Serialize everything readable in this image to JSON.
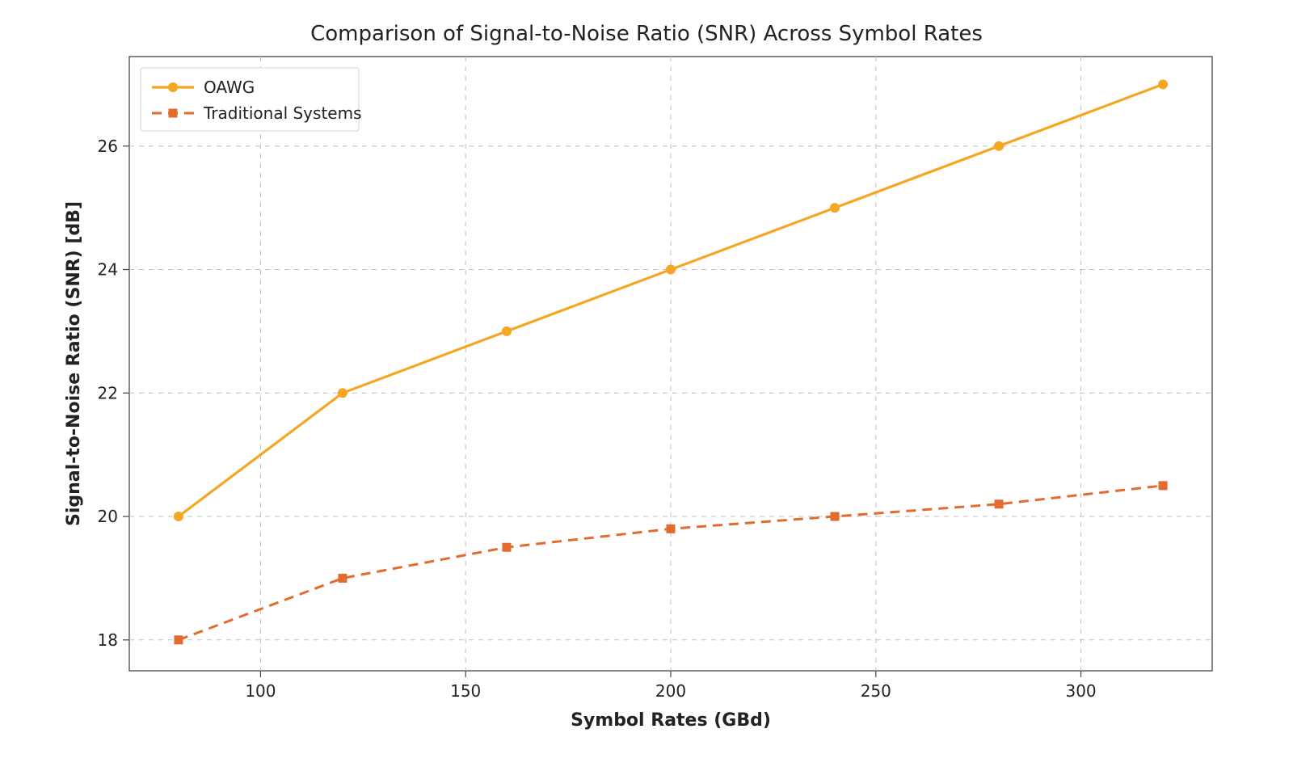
{
  "chart_data": {
    "type": "line",
    "title": "Comparison of Signal-to-Noise Ratio (SNR) Across Symbol Rates",
    "xlabel": "Symbol Rates (GBd)",
    "ylabel": "Signal-to-Noise Ratio (SNR) [dB]",
    "x": [
      80,
      120,
      160,
      200,
      240,
      280,
      320
    ],
    "series": [
      {
        "name": "OAWG",
        "values": [
          20,
          22,
          23,
          24,
          25,
          26,
          27
        ]
      },
      {
        "name": "Traditional Systems",
        "values": [
          18,
          19,
          19.5,
          19.8,
          20,
          20.2,
          20.5
        ]
      }
    ],
    "xlim": [
      68,
      332
    ],
    "ylim": [
      17.5,
      27.45
    ],
    "xticks": [
      100,
      150,
      200,
      250,
      300
    ],
    "yticks": [
      18,
      20,
      22,
      24,
      26
    ],
    "legend_position": "upper-left",
    "grid": true
  }
}
